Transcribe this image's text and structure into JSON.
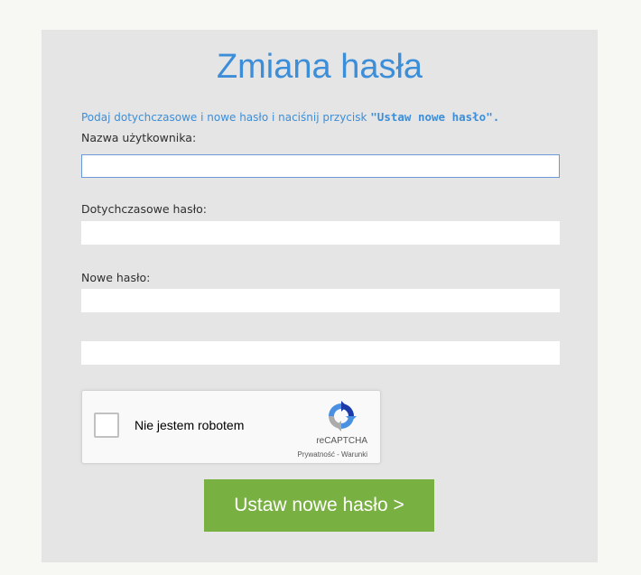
{
  "form": {
    "title": "Zmiana hasła",
    "intro_text": "Podaj dotychczasowe i nowe hasło i naciśnij przycisk ",
    "intro_button_ref": "\"Ustaw nowe hasło\".",
    "username_label": "Nazwa użytkownika:",
    "username_value": "",
    "old_password_label": "Dotychczasowe hasło:",
    "old_password_value": "",
    "new_password_label": "Nowe hasło:",
    "new_password_value": "",
    "confirm_password_value": "",
    "submit_label": "Ustaw nowe hasło >"
  },
  "captcha": {
    "checkbox_label": "Nie jestem robotem",
    "brand": "reCAPTCHA",
    "links": "Prywatność - Warunki",
    "icon": "recaptcha-logo"
  },
  "colors": {
    "accent_blue": "#3d8ed9",
    "button_green": "#78b042",
    "panel_gray": "#e5e5e5"
  }
}
